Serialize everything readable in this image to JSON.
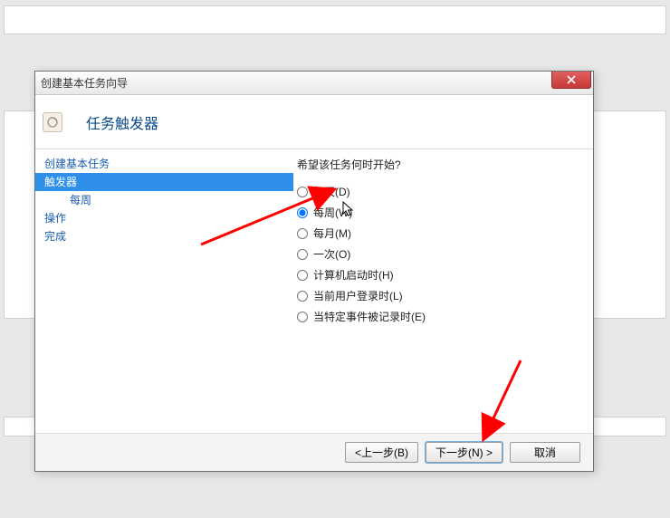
{
  "dialog": {
    "title": "创建基本任务向导",
    "header_title": "任务触发器"
  },
  "sidebar": {
    "items": [
      {
        "label": "创建基本任务",
        "active": false,
        "indent": false
      },
      {
        "label": "触发器",
        "active": true,
        "indent": false
      },
      {
        "label": "每周",
        "active": false,
        "indent": true
      },
      {
        "label": "操作",
        "active": false,
        "indent": false
      },
      {
        "label": "完成",
        "active": false,
        "indent": false
      }
    ]
  },
  "main": {
    "prompt": "希望该任务何时开始?",
    "selected": "weekly",
    "options": [
      {
        "id": "daily",
        "label": "每天(D)"
      },
      {
        "id": "weekly",
        "label": "每周(W)"
      },
      {
        "id": "monthly",
        "label": "每月(M)"
      },
      {
        "id": "once",
        "label": "一次(O)"
      },
      {
        "id": "startup",
        "label": "计算机启动时(H)"
      },
      {
        "id": "logon",
        "label": "当前用户登录时(L)"
      },
      {
        "id": "event",
        "label": "当特定事件被记录时(E)"
      }
    ]
  },
  "buttons": {
    "back": "<上一步(B)",
    "next": "下一步(N) >",
    "cancel": "取消"
  },
  "annotation": {
    "arrow1_color": "#ff0000",
    "arrow2_color": "#ff0000"
  }
}
